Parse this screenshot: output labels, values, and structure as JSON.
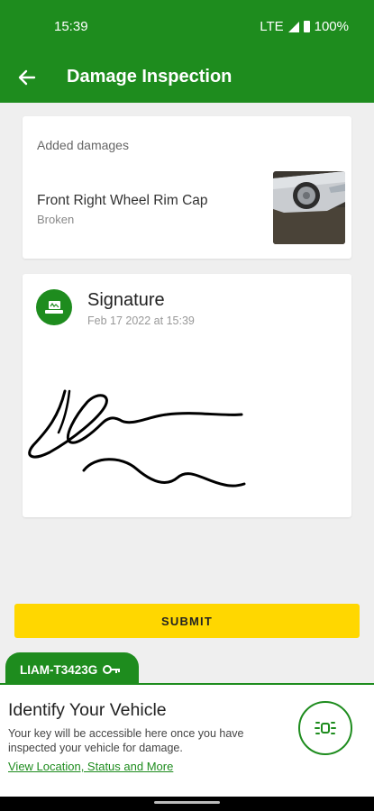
{
  "status_bar": {
    "time": "15:39",
    "network": "LTE",
    "battery": "100%"
  },
  "app_bar": {
    "title": "Damage Inspection"
  },
  "damages": {
    "header": "Added damages",
    "items": [
      {
        "name": "Front Right Wheel Rim Cap",
        "status": "Broken"
      }
    ]
  },
  "signature": {
    "title": "Signature",
    "date": "Feb 17 2022 at 15:39"
  },
  "submit_label": "SUBMIT",
  "vehicle_tab": {
    "plate": "LIAM-T3423G"
  },
  "vehicle_panel": {
    "title": "Identify Your Vehicle",
    "description": "Your key will be accessible here once you have inspected your vehicle for damage.",
    "link": "View Location, Status and More"
  },
  "colors": {
    "primary": "#1e8c1e",
    "accent": "#ffd700",
    "background": "#efefef"
  }
}
